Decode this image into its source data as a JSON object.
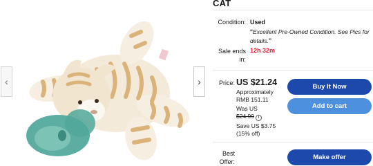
{
  "gallery": {
    "prev_label": "‹",
    "next_label": "›",
    "image_subject": "plush-cat-pacifier"
  },
  "listing": {
    "title": "CAT",
    "condition_label": "Condition:",
    "condition_value": "Used",
    "condition_note_open": "“",
    "condition_note": "Excellent Pre-Owned Condition. See Pics for details.",
    "condition_note_close": "”",
    "sale_ends_label": "Sale ends in:",
    "sale_ends_value": "12h 32m"
  },
  "pricing": {
    "price_label": "Price:",
    "price_value": "US $21.24",
    "approx_text": "Approximately RMB 151.11",
    "was_label": "Was US",
    "was_value": "$24.99",
    "info_icon": "i",
    "save_text": "Save US $3.75 (15% off)"
  },
  "actions": {
    "buy_now": "Buy It Now",
    "add_to_cart": "Add to cart",
    "best_offer_label": "Best Offer:",
    "make_offer": "Make offer"
  },
  "colors": {
    "primary_button": "#1d49ad",
    "secondary_button": "#4d90de",
    "sale_red": "#dd1e31"
  }
}
